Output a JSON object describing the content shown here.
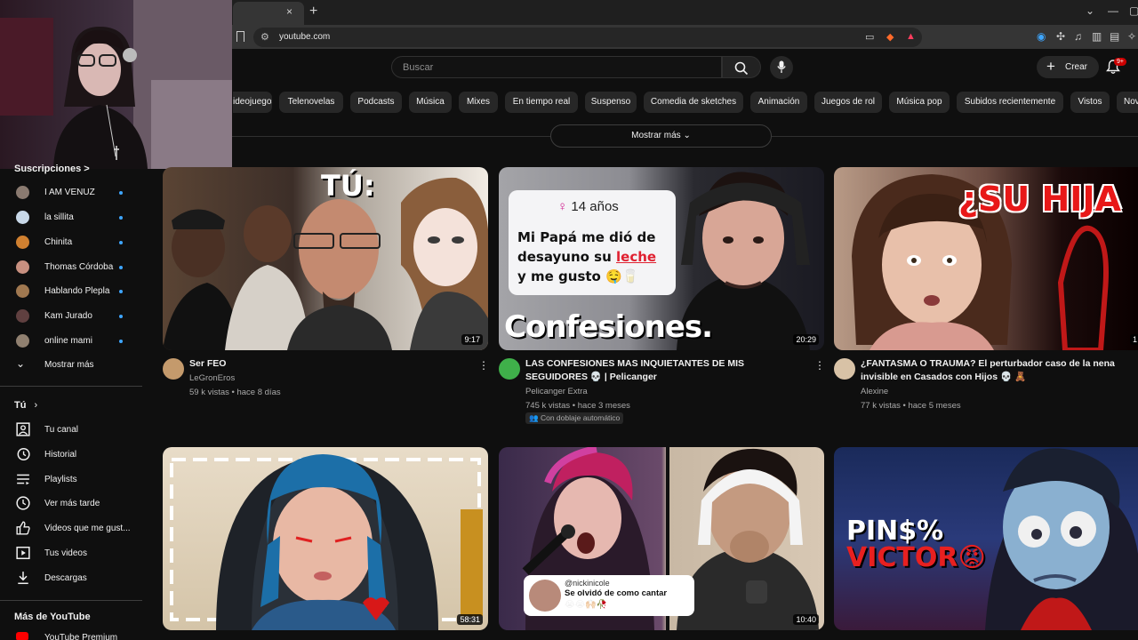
{
  "browser": {
    "url": "youtube.com",
    "tab_close": "×",
    "new_tab": "+"
  },
  "header": {
    "search_placeholder": "Buscar",
    "create_label": "Crear",
    "notifications_badge": "9+"
  },
  "chips": [
    "ideojuegos",
    "Telenovelas",
    "Podcasts",
    "Música",
    "Mixes",
    "En tiempo real",
    "Suspenso",
    "Comedia de sketches",
    "Animación",
    "Juegos de rol",
    "Música pop",
    "Subidos recientemente",
    "Vistos",
    "Nov"
  ],
  "show_more": "Mostrar más",
  "sidebar": {
    "subscriptions_header": "Suscripciones  >",
    "subscriptions": [
      {
        "name": "I AM VENUZ",
        "color": "#8a7a70"
      },
      {
        "name": "la sillita",
        "color": "#c8d8e8"
      },
      {
        "name": "Chinita",
        "color": "#d08030"
      },
      {
        "name": "Thomas Córdoba",
        "color": "#c89080"
      },
      {
        "name": "Hablando Plepla",
        "color": "#a07850"
      },
      {
        "name": "Kam Jurado",
        "color": "#604040"
      },
      {
        "name": "online mami",
        "color": "#908070"
      }
    ],
    "show_more": "Mostrar más",
    "you_header": "Tú",
    "you_items": [
      "Tu canal",
      "Historial",
      "Playlists",
      "Ver más tarde",
      "Videos que me gust...",
      "Tus videos",
      "Descargas"
    ],
    "more_header": "Más de YouTube",
    "more_items": [
      "YouTube Premium"
    ]
  },
  "videos": [
    {
      "title": "Ser FEO",
      "channel": "LeGronEros",
      "meta": "59 k vistas • hace 8 días",
      "duration": "9:17",
      "overlay": "TÚ:"
    },
    {
      "title": "LAS CONFESIONES MAS INQUIETANTES DE MIS SEGUIDORES 💀 | Pelicanger",
      "channel": "Pelicanger Extra",
      "meta": "745 k vistas • hace 3 meses",
      "dub": "Con doblaje automático",
      "duration": "20:29",
      "overlay": "Confesiones.",
      "card_age": "14 años",
      "card_line1": "Mi Papá me dió de",
      "card_line2": "desayuno su",
      "card_word": "leche",
      "card_line3": "y me gusto 🤤🥛"
    },
    {
      "title": "¿FANTASMA O TRAUMA? El perturbador caso de la nena invisible en Casados con Hijos 💀 🧸",
      "channel": "Alexine",
      "meta": "77 k vistas • hace 5 meses",
      "duration": "1",
      "overlay": "¿SU HIJA"
    },
    {
      "title": "",
      "duration": "58:31",
      "overlay": ""
    },
    {
      "title": "",
      "duration": "10:40",
      "overlay_handle": "@nickinicole",
      "overlay_caption": "Se olvidó de como cantar",
      "overlay_emoji": "😭😭🙌🏻🥀"
    },
    {
      "title": "",
      "duration": "",
      "overlay_line1": "PIN$%",
      "overlay_line2": "VICTOR😡"
    }
  ]
}
